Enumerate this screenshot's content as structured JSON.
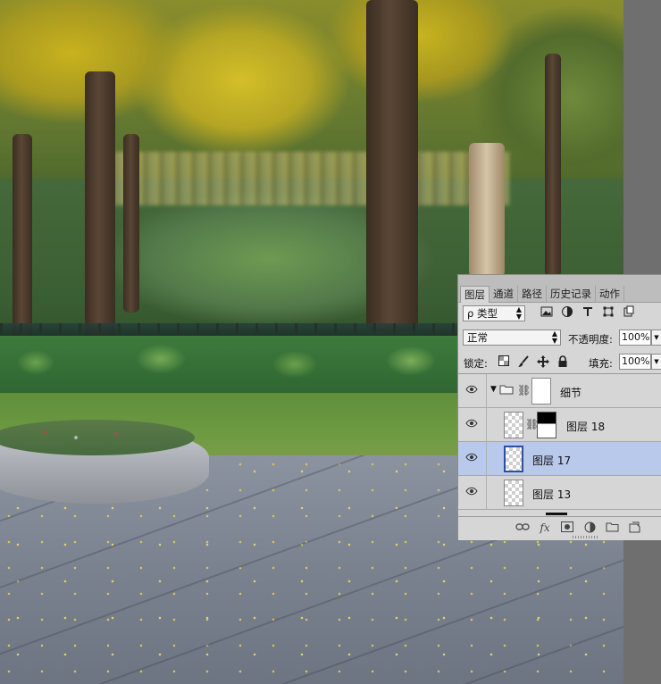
{
  "layers_panel": {
    "tabs": [
      {
        "label": "图层",
        "active": true
      },
      {
        "label": "通道",
        "active": false
      },
      {
        "label": "路径",
        "active": false
      },
      {
        "label": "历史记录",
        "active": false
      },
      {
        "label": "动作",
        "active": false
      }
    ],
    "filter": {
      "kind_label": "ρ 类型",
      "icons": [
        "image-filter-icon",
        "adjustment-filter-icon",
        "type-filter-icon",
        "shape-filter-icon",
        "smart-object-filter-icon"
      ]
    },
    "blend_mode": "正常",
    "opacity_label": "不透明度:",
    "opacity_value": "100%",
    "lock_label": "锁定:",
    "lock_icons": [
      "lock-transparent-icon",
      "lock-image-icon",
      "lock-position-icon",
      "lock-all-icon"
    ],
    "fill_label": "填充:",
    "fill_value": "100%",
    "layers": [
      {
        "name": "细节",
        "type": "group",
        "expanded": true,
        "selected": false
      },
      {
        "name": "图层 18",
        "type": "layer-with-mask",
        "selected": false
      },
      {
        "name": "图层 17",
        "type": "layer",
        "selected": true
      },
      {
        "name": "图层 13",
        "type": "layer",
        "selected": false
      }
    ],
    "bottom_icons": [
      "link-layers-icon",
      "fx-icon",
      "add-mask-icon",
      "adjustment-layer-icon",
      "new-group-icon",
      "new-layer-icon"
    ],
    "fx_label": "fx"
  }
}
